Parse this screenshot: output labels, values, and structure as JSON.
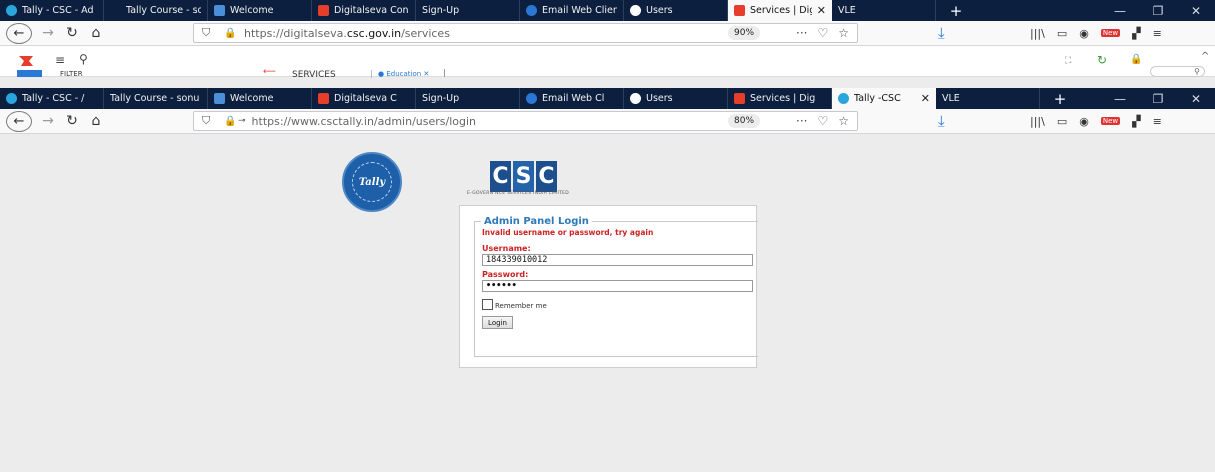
{
  "outer_tabs": [
    {
      "label": "Tally - CSC - Ad",
      "icon": "tally-icon",
      "color": "#2aa6dd"
    },
    {
      "label": "Tally Course - sonu",
      "icon": "tally-icon",
      "color": "#0c1f3f"
    },
    {
      "label": "Welcome",
      "icon": "image-icon",
      "color": "#4a8fd8"
    },
    {
      "label": "Digitalseva Con",
      "icon": "digitalseva-icon",
      "color": "#e63e2b"
    },
    {
      "label": "Sign-Up",
      "icon": "",
      "color": "#0c1f3f"
    },
    {
      "label": "Email Web Clien",
      "icon": "email-icon",
      "color": "#2a77d6"
    },
    {
      "label": "Users",
      "icon": "users-icon",
      "color": "#ffffff"
    },
    {
      "label": "Services | Dig",
      "icon": "digitalseva-icon",
      "color": "#e63e2b",
      "active": true
    },
    {
      "label": "VLE",
      "icon": "",
      "color": "#0c1f3f"
    }
  ],
  "outer_nav": {
    "url_prefix": "https://digitalseva.",
    "url_domain": "csc.gov.in",
    "url_suffix": "/services",
    "zoom": "90%"
  },
  "csc_bar": {
    "filter_label": "FILTER",
    "services_label": "SERVICES",
    "education_tab": "Education"
  },
  "inner_tabs": [
    {
      "label": "Tally - CSC - /",
      "icon": "tally-icon",
      "color": "#2aa6dd"
    },
    {
      "label": "Tally Course - sonu",
      "icon": "",
      "color": "#0c1f3f"
    },
    {
      "label": "Welcome",
      "icon": "image-icon",
      "color": "#4a8fd8"
    },
    {
      "label": "Digitalseva C",
      "icon": "digitalseva-icon",
      "color": "#e63e2b"
    },
    {
      "label": "Sign-Up",
      "icon": "",
      "color": "#0c1f3f"
    },
    {
      "label": "Email Web Cl",
      "icon": "email-icon",
      "color": "#2a77d6"
    },
    {
      "label": "Users",
      "icon": "users-icon",
      "color": "#ffffff"
    },
    {
      "label": "Services | Dig",
      "icon": "digitalseva-icon",
      "color": "#e63e2b"
    },
    {
      "label": "Tally -CSC",
      "icon": "tally-icon",
      "color": "#2aa6dd",
      "active": true
    },
    {
      "label": "VLE",
      "icon": "",
      "color": "#0c1f3f"
    }
  ],
  "inner_nav": {
    "url": "https://www.csctally.in/admin/users/login",
    "zoom": "80%"
  },
  "logos": {
    "tally_text": "Tally",
    "csc_text": "CSC",
    "csc_subtitle": "E-GOVERN NCE SERVICES INDIA LIMITED"
  },
  "login": {
    "legend": "Admin Panel Login",
    "error": "Invalid username or password, try again",
    "username_label": "Username:",
    "username_value": "184339010012",
    "password_label": "Password:",
    "password_value": "••••••",
    "remember_label": "Remember me",
    "login_button": "Login"
  },
  "new_badge": "New"
}
